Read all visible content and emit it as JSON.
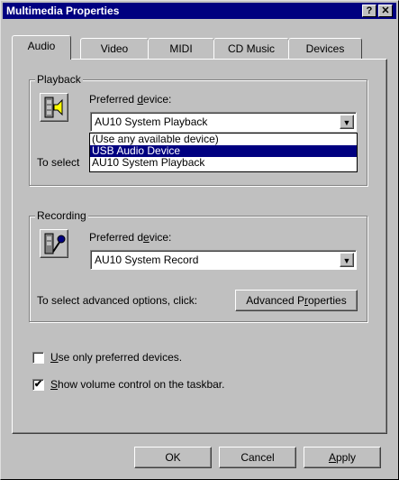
{
  "window": {
    "title": "Multimedia Properties"
  },
  "titlebar": {
    "help_glyph": "?",
    "close_glyph": "✕"
  },
  "tabs": [
    {
      "label": "Audio"
    },
    {
      "label": "Video"
    },
    {
      "label": "MIDI"
    },
    {
      "label": "CD Music"
    },
    {
      "label": "Devices"
    }
  ],
  "playback": {
    "legend": "Playback",
    "preferred_label_pre": "Preferred ",
    "preferred_label_accel": "d",
    "preferred_label_post": "evice:",
    "selected": "AU10 System Playback",
    "options": [
      "(Use any available device)",
      "USB Audio Device",
      "AU10 System Playback"
    ],
    "highlighted_index": 1,
    "advanced_text_partial": "To select"
  },
  "recording": {
    "legend": "Recording",
    "preferred_label_pre": "Preferred d",
    "preferred_label_accel": "e",
    "preferred_label_post": "vice:",
    "selected": "AU10 System Record",
    "advanced_text": "To select advanced options, click:",
    "advanced_button_pre": "Advanced P",
    "advanced_button_accel": "r",
    "advanced_button_post": "operties"
  },
  "checkboxes": [
    {
      "accel": "U",
      "rest": "se only preferred devices.",
      "checked": false
    },
    {
      "accel": "S",
      "rest": "how volume control on the taskbar.",
      "checked": true
    }
  ],
  "buttons": {
    "ok": "OK",
    "cancel": "Cancel",
    "apply_accel": "A",
    "apply_rest": "pply"
  },
  "check_glyph": "✔",
  "arrow_glyph": "▼"
}
